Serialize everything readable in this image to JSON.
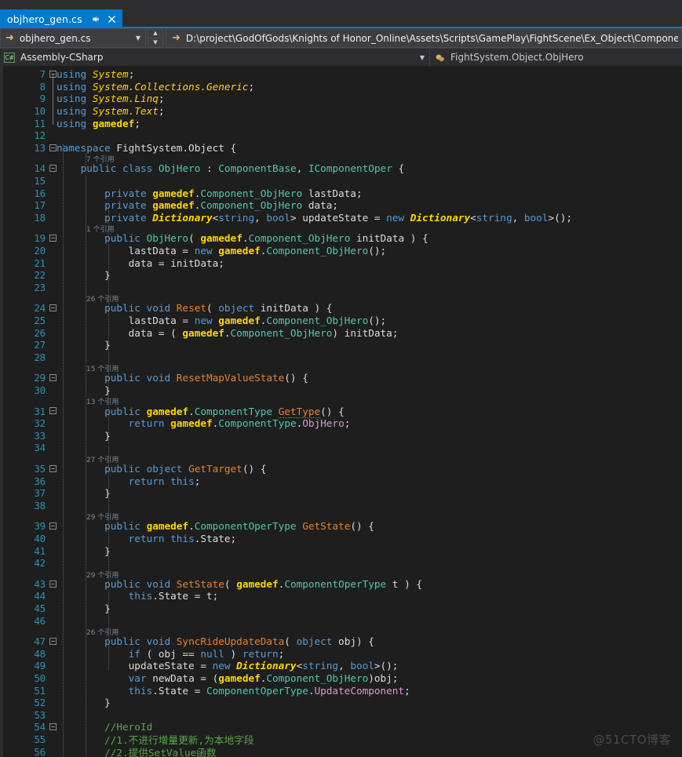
{
  "tab": {
    "title": "objhero_gen.cs",
    "pin_icon": "pin-icon",
    "close_icon": "close-icon"
  },
  "navbar": {
    "arrow_icon": "forward-arrow-icon",
    "file_combo_value": "objhero_gen.cs",
    "caret_icon": "chevron-down-icon",
    "spin_up_icon": "chevron-up-icon",
    "spin_down_icon": "chevron-down-icon",
    "path_arrow_icon": "forward-arrow-icon",
    "path": "D:\\project\\GodOfGods\\Knights of Honor_Online\\Assets\\Scripts\\GamePlay\\FightScene\\Ex_Object\\Components\\"
  },
  "breadcrumb": {
    "project_badge": "C#",
    "project_name": "Assembly-CSharp",
    "caret_icon": "chevron-down-icon",
    "type_icon": "class-icon",
    "type_name": "FightSystem.Object.ObjHero"
  },
  "editor": {
    "lines": [
      {
        "n": 7,
        "fold": "minus",
        "tokens": [
          [
            "kw",
            "using "
          ],
          [
            "ns",
            "System"
          ],
          [
            "op",
            ";"
          ]
        ]
      },
      {
        "n": 8,
        "fold": "",
        "tokens": [
          [
            "kw",
            "using "
          ],
          [
            "ns",
            "System.Collections.Generic"
          ],
          [
            "op",
            ";"
          ]
        ]
      },
      {
        "n": 9,
        "fold": "",
        "tokens": [
          [
            "kw",
            "using "
          ],
          [
            "ns",
            "System.Linq"
          ],
          [
            "op",
            ";"
          ]
        ]
      },
      {
        "n": 10,
        "fold": "",
        "tokens": [
          [
            "kw",
            "using "
          ],
          [
            "ns",
            "System.Text"
          ],
          [
            "op",
            ";"
          ]
        ]
      },
      {
        "n": 11,
        "fold": "",
        "tokens": [
          [
            "kw",
            "using "
          ],
          [
            "nsb",
            "gamedef"
          ],
          [
            "op",
            ";"
          ]
        ]
      },
      {
        "n": 12,
        "fold": "",
        "tokens": []
      },
      {
        "n": 13,
        "fold": "minus",
        "tokens": [
          [
            "kw",
            "namespace "
          ],
          [
            "id",
            "FightSystem.Object {"
          ]
        ]
      },
      {
        "n": 14,
        "fold": "minus",
        "lens": "7 个引用",
        "tokens": [
          [
            "op",
            "    "
          ],
          [
            "kw",
            "public "
          ],
          [
            "kw",
            "class "
          ],
          [
            "type",
            "ObjHero"
          ],
          [
            "op",
            " : "
          ],
          [
            "type",
            "ComponentBase"
          ],
          [
            "op",
            ", "
          ],
          [
            "type",
            "IComponentOper"
          ],
          [
            "op",
            " {"
          ]
        ]
      },
      {
        "n": 15,
        "fold": "",
        "tokens": []
      },
      {
        "n": 16,
        "fold": "",
        "tokens": [
          [
            "op",
            "        "
          ],
          [
            "kw",
            "private "
          ],
          [
            "nsb",
            "gamedef"
          ],
          [
            "op",
            "."
          ],
          [
            "type",
            "Component_ObjHero"
          ],
          [
            "op",
            " lastData;"
          ]
        ]
      },
      {
        "n": 17,
        "fold": "",
        "tokens": [
          [
            "op",
            "        "
          ],
          [
            "kw",
            "private "
          ],
          [
            "nsb",
            "gamedef"
          ],
          [
            "op",
            "."
          ],
          [
            "type",
            "Component_ObjHero"
          ],
          [
            "op",
            " data;"
          ]
        ]
      },
      {
        "n": 18,
        "fold": "",
        "tokens": [
          [
            "op",
            "        "
          ],
          [
            "kw",
            "private "
          ],
          [
            "cls",
            "Dictionary"
          ],
          [
            "op",
            "<"
          ],
          [
            "kw",
            "string"
          ],
          [
            "op",
            ", "
          ],
          [
            "kw",
            "bool"
          ],
          [
            "op",
            "> updateState = "
          ],
          [
            "kw",
            "new "
          ],
          [
            "cls",
            "Dictionary"
          ],
          [
            "op",
            "<"
          ],
          [
            "kw",
            "string"
          ],
          [
            "op",
            ", "
          ],
          [
            "kw",
            "bool"
          ],
          [
            "op",
            ">();"
          ]
        ]
      },
      {
        "n": 19,
        "fold": "minus",
        "lens": "1 个引用",
        "tokens": [
          [
            "op",
            "        "
          ],
          [
            "kw",
            "public "
          ],
          [
            "type",
            "ObjHero"
          ],
          [
            "op",
            "( "
          ],
          [
            "nsb",
            "gamedef"
          ],
          [
            "op",
            "."
          ],
          [
            "type",
            "Component_ObjHero"
          ],
          [
            "op",
            " initData ) {"
          ]
        ]
      },
      {
        "n": 20,
        "fold": "",
        "tokens": [
          [
            "op",
            "            lastData = "
          ],
          [
            "kw",
            "new "
          ],
          [
            "nsb",
            "gamedef"
          ],
          [
            "op",
            "."
          ],
          [
            "type",
            "Component_ObjHero"
          ],
          [
            "op",
            "();"
          ]
        ]
      },
      {
        "n": 21,
        "fold": "",
        "tokens": [
          [
            "op",
            "            data = initData;"
          ]
        ]
      },
      {
        "n": 22,
        "fold": "",
        "tokens": [
          [
            "op",
            "        }"
          ]
        ]
      },
      {
        "n": 23,
        "fold": "",
        "tokens": []
      },
      {
        "n": 24,
        "fold": "minus",
        "lens": "26 个引用",
        "tokens": [
          [
            "op",
            "        "
          ],
          [
            "kw",
            "public "
          ],
          [
            "kw",
            "void "
          ],
          [
            "mth",
            "Reset"
          ],
          [
            "op",
            "( "
          ],
          [
            "kw",
            "object"
          ],
          [
            "op",
            " initData ) {"
          ]
        ]
      },
      {
        "n": 25,
        "fold": "",
        "tokens": [
          [
            "op",
            "            lastData = "
          ],
          [
            "kw",
            "new "
          ],
          [
            "nsb",
            "gamedef"
          ],
          [
            "op",
            "."
          ],
          [
            "type",
            "Component_ObjHero"
          ],
          [
            "op",
            "();"
          ]
        ]
      },
      {
        "n": 26,
        "fold": "",
        "tokens": [
          [
            "op",
            "            data = ( "
          ],
          [
            "nsb",
            "gamedef"
          ],
          [
            "op",
            "."
          ],
          [
            "type",
            "Component_ObjHero"
          ],
          [
            "op",
            ") initData;"
          ]
        ]
      },
      {
        "n": 27,
        "fold": "",
        "tokens": [
          [
            "op",
            "        }"
          ]
        ]
      },
      {
        "n": 28,
        "fold": "",
        "tokens": []
      },
      {
        "n": 29,
        "fold": "minus",
        "lens": "15 个引用",
        "tokens": [
          [
            "op",
            "        "
          ],
          [
            "kw",
            "public "
          ],
          [
            "kw",
            "void "
          ],
          [
            "mth",
            "ResetMapValueState"
          ],
          [
            "op",
            "() {"
          ]
        ]
      },
      {
        "n": 30,
        "fold": "",
        "tokens": [
          [
            "op",
            "        }"
          ]
        ]
      },
      {
        "n": 31,
        "fold": "minus",
        "lens": "13 个引用",
        "tokens": [
          [
            "op",
            "        "
          ],
          [
            "kw",
            "public "
          ],
          [
            "nsb",
            "gamedef"
          ],
          [
            "op",
            "."
          ],
          [
            "type",
            "ComponentType"
          ],
          [
            "op",
            " "
          ],
          [
            "mthsq",
            "GetType"
          ],
          [
            "op",
            "() {"
          ]
        ]
      },
      {
        "n": 32,
        "fold": "",
        "tokens": [
          [
            "op",
            "            "
          ],
          [
            "kwctl",
            "return "
          ],
          [
            "nsb",
            "gamedef"
          ],
          [
            "op",
            "."
          ],
          [
            "type",
            "ComponentType"
          ],
          [
            "op",
            "."
          ],
          [
            "enm",
            "ObjHero"
          ],
          [
            "op",
            ";"
          ]
        ]
      },
      {
        "n": 33,
        "fold": "",
        "tokens": [
          [
            "op",
            "        }"
          ]
        ]
      },
      {
        "n": 34,
        "fold": "",
        "tokens": []
      },
      {
        "n": 35,
        "fold": "minus",
        "lens": "27 个引用",
        "tokens": [
          [
            "op",
            "        "
          ],
          [
            "kw",
            "public "
          ],
          [
            "kw",
            "object "
          ],
          [
            "mth",
            "GetTarget"
          ],
          [
            "op",
            "() {"
          ]
        ]
      },
      {
        "n": 36,
        "fold": "",
        "tokens": [
          [
            "op",
            "            "
          ],
          [
            "kwctl",
            "return "
          ],
          [
            "kw",
            "this"
          ],
          [
            "op",
            ";"
          ]
        ]
      },
      {
        "n": 37,
        "fold": "",
        "tokens": [
          [
            "op",
            "        }"
          ]
        ]
      },
      {
        "n": 38,
        "fold": "",
        "tokens": []
      },
      {
        "n": 39,
        "fold": "minus",
        "lens": "29 个引用",
        "tokens": [
          [
            "op",
            "        "
          ],
          [
            "kw",
            "public "
          ],
          [
            "nsb",
            "gamedef"
          ],
          [
            "op",
            "."
          ],
          [
            "type",
            "ComponentOperType"
          ],
          [
            "op",
            " "
          ],
          [
            "mth",
            "GetState"
          ],
          [
            "op",
            "() {"
          ]
        ]
      },
      {
        "n": 40,
        "fold": "",
        "tokens": [
          [
            "op",
            "            "
          ],
          [
            "kwctl",
            "return "
          ],
          [
            "kw",
            "this"
          ],
          [
            "op",
            ".State;"
          ]
        ]
      },
      {
        "n": 41,
        "fold": "",
        "tokens": [
          [
            "op",
            "        }"
          ]
        ]
      },
      {
        "n": 42,
        "fold": "",
        "tokens": []
      },
      {
        "n": 43,
        "fold": "minus",
        "lens": "29 个引用",
        "tokens": [
          [
            "op",
            "        "
          ],
          [
            "kw",
            "public "
          ],
          [
            "kw",
            "void "
          ],
          [
            "mth",
            "SetState"
          ],
          [
            "op",
            "( "
          ],
          [
            "nsb",
            "gamedef"
          ],
          [
            "op",
            "."
          ],
          [
            "type",
            "ComponentOperType"
          ],
          [
            "op",
            " t ) {"
          ]
        ]
      },
      {
        "n": 44,
        "fold": "",
        "tokens": [
          [
            "op",
            "            "
          ],
          [
            "kw",
            "this"
          ],
          [
            "op",
            ".State = t;"
          ]
        ]
      },
      {
        "n": 45,
        "fold": "",
        "tokens": [
          [
            "op",
            "        }"
          ]
        ]
      },
      {
        "n": 46,
        "fold": "",
        "tokens": []
      },
      {
        "n": 47,
        "fold": "minus",
        "lens": "26 个引用",
        "tokens": [
          [
            "op",
            "        "
          ],
          [
            "kw",
            "public "
          ],
          [
            "kw",
            "void "
          ],
          [
            "mth",
            "SyncRideUpdateData"
          ],
          [
            "op",
            "( "
          ],
          [
            "kw",
            "object"
          ],
          [
            "op",
            " obj) {"
          ]
        ]
      },
      {
        "n": 48,
        "fold": "",
        "tokens": [
          [
            "op",
            "            "
          ],
          [
            "kwctl",
            "if"
          ],
          [
            "op",
            " ( obj == "
          ],
          [
            "kw",
            "null"
          ],
          [
            "op",
            " ) "
          ],
          [
            "kwctl",
            "return"
          ],
          [
            "op",
            ";"
          ]
        ]
      },
      {
        "n": 49,
        "fold": "",
        "tokens": [
          [
            "op",
            "            updateState = "
          ],
          [
            "kw",
            "new "
          ],
          [
            "cls",
            "Dictionary"
          ],
          [
            "op",
            "<"
          ],
          [
            "kw",
            "string"
          ],
          [
            "op",
            ", "
          ],
          [
            "kw",
            "bool"
          ],
          [
            "op",
            ">();"
          ]
        ]
      },
      {
        "n": 50,
        "fold": "",
        "tokens": [
          [
            "op",
            "            "
          ],
          [
            "kw",
            "var"
          ],
          [
            "op",
            " newData = ("
          ],
          [
            "nsb",
            "gamedef"
          ],
          [
            "op",
            "."
          ],
          [
            "type",
            "Component_ObjHero"
          ],
          [
            "op",
            ")obj;"
          ]
        ]
      },
      {
        "n": 51,
        "fold": "",
        "tokens": [
          [
            "op",
            "            "
          ],
          [
            "kw",
            "this"
          ],
          [
            "op",
            ".State = "
          ],
          [
            "type",
            "ComponentOperType"
          ],
          [
            "op",
            "."
          ],
          [
            "enm",
            "UpdateComponent"
          ],
          [
            "op",
            ";"
          ]
        ]
      },
      {
        "n": 52,
        "fold": "",
        "tokens": [
          [
            "op",
            "        }"
          ]
        ]
      },
      {
        "n": 53,
        "fold": "",
        "tokens": []
      },
      {
        "n": 54,
        "fold": "minus",
        "tokens": [
          [
            "cmt",
            "        //HeroId"
          ]
        ]
      },
      {
        "n": 55,
        "fold": "",
        "tokens": [
          [
            "cmt",
            "        //1.不进行增量更新,为本地字段"
          ]
        ]
      },
      {
        "n": 56,
        "fold": "",
        "tokens": [
          [
            "cmt",
            "        //2.提供SetValue函数"
          ]
        ]
      }
    ]
  },
  "watermark": "@51CTO博客"
}
